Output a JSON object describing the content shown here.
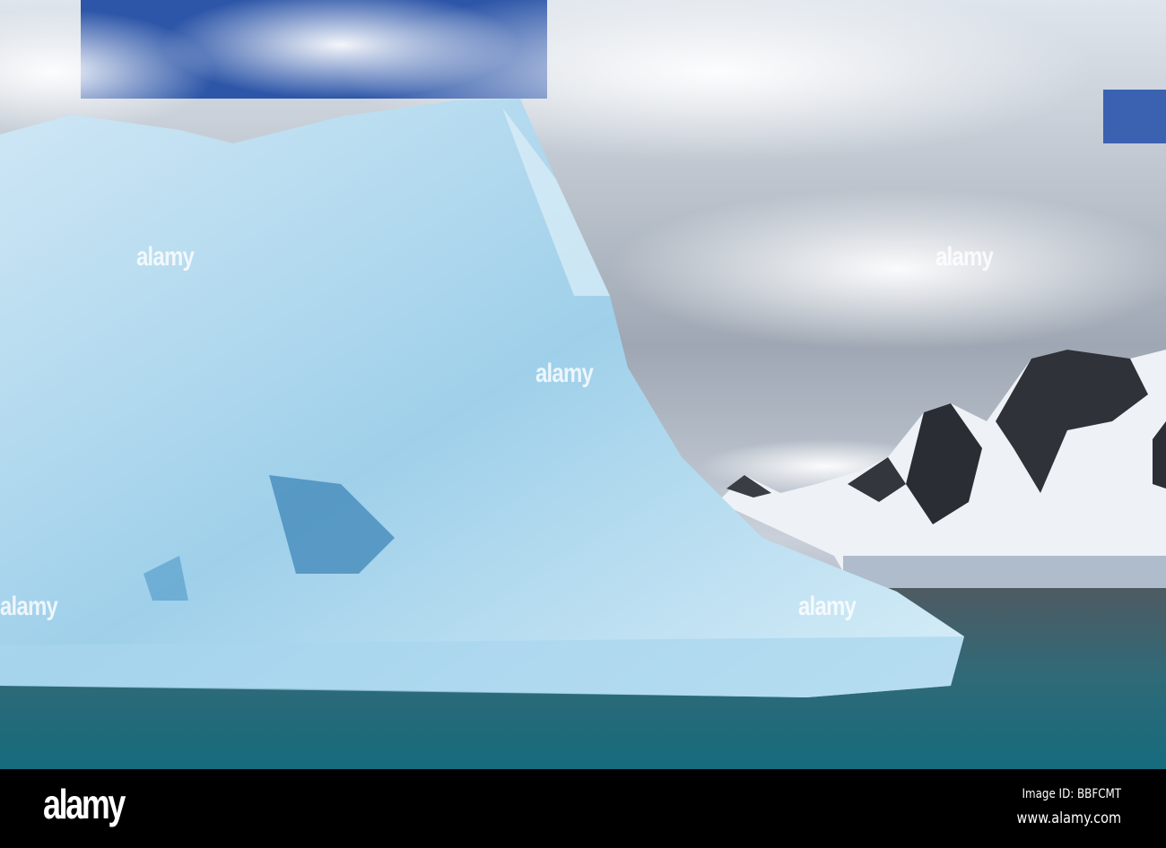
{
  "photo": {
    "subject": "Iceberg with snow-covered mountains and sea"
  },
  "watermark": {
    "text": "alamy"
  },
  "footer": {
    "logo": "alamy",
    "image_id": "Image ID: BBFCMT",
    "website": "www.alamy.com"
  }
}
